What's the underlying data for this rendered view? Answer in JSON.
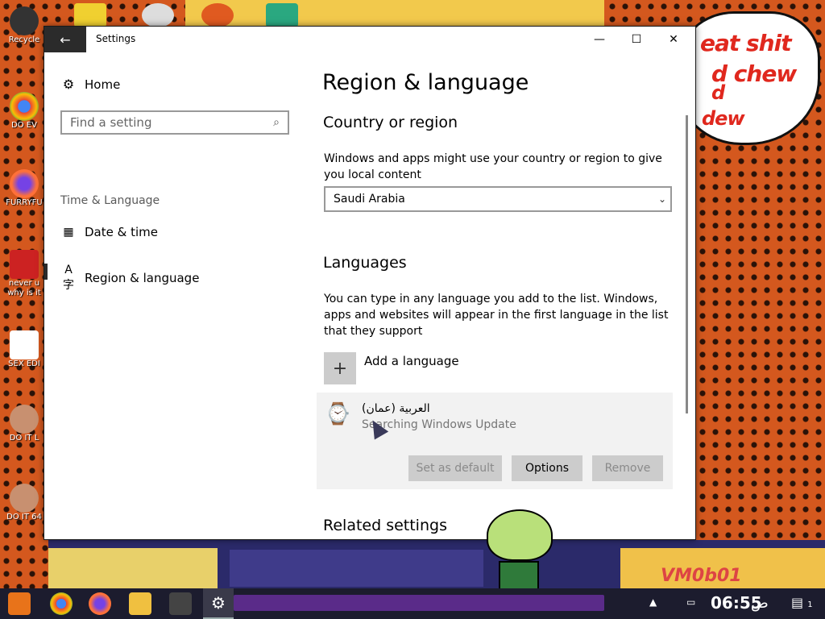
{
  "desktop": {
    "bubble_lines": [
      "eat shit",
      "d chew",
      "d",
      "dew"
    ],
    "wallpaper_tag": "VM0b01",
    "icons": [
      {
        "label": "Recycle",
        "color": "#333333"
      },
      {
        "label": "DO EV",
        "color": "#4285f4"
      },
      {
        "label": "FURRYFU",
        "color": "#ff7139"
      },
      {
        "label": "never u why is it",
        "color": "#cc2222"
      },
      {
        "label": "SEX EDI",
        "color": "#ffffff"
      },
      {
        "label": "DO IT L",
        "color": "#c89070"
      },
      {
        "label": "DO IT 64",
        "color": "#c89070"
      }
    ]
  },
  "window": {
    "title": "Settings",
    "back_icon": "←",
    "minimize_icon": "—",
    "maximize_icon": "☐",
    "close_icon": "✕"
  },
  "sidebar": {
    "home_label": "Home",
    "search_placeholder": "Find a setting",
    "section_label": "Time & Language",
    "items": [
      {
        "label": "Date & time"
      },
      {
        "label": "Region & language"
      }
    ]
  },
  "main": {
    "page_title": "Region & language",
    "country": {
      "heading": "Country or region",
      "description": "Windows and apps might use your country or region to give you local content",
      "selected": "Saudi Arabia"
    },
    "languages": {
      "heading": "Languages",
      "description": "You can type in any language you add to the list. Windows, apps and websites will appear in the first language in the list that they support",
      "add_label": "Add a language",
      "entry": {
        "name": "العربية (عمان)",
        "status": "Searching Windows Update"
      },
      "buttons": {
        "set_default": "Set as default",
        "options": "Options",
        "remove": "Remove"
      }
    },
    "related_heading": "Related settings"
  },
  "taskbar": {
    "clock": "06:55",
    "ampm": "ص",
    "notification_count": "1"
  }
}
